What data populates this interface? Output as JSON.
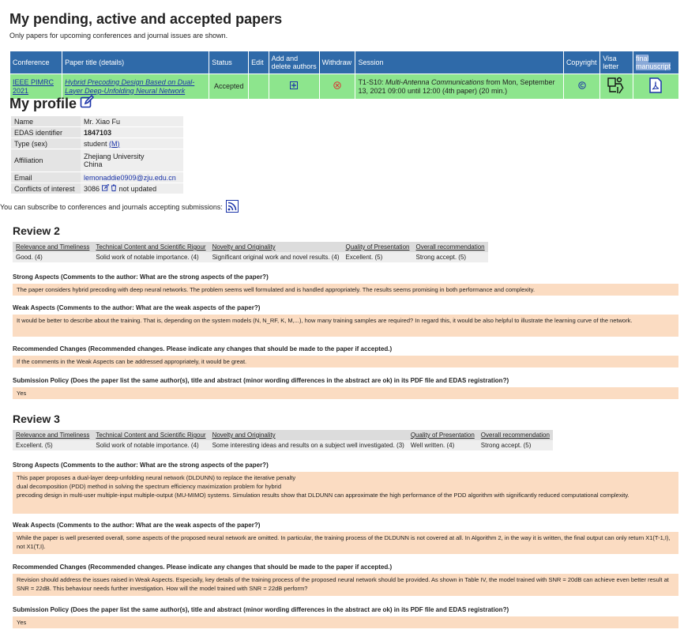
{
  "page": {
    "title": "My pending, active and accepted papers",
    "subtitle": "Only papers for upcoming conferences and journal issues are shown."
  },
  "papers": {
    "headers": [
      "Conference",
      "Paper title (details)",
      "Status",
      "Edit",
      "Add and delete authors",
      "Withdraw",
      "Session",
      "Copyright",
      "Visa letter",
      "final manuscript"
    ],
    "row": {
      "conference": "IEEE PIMRC 2021",
      "title": "Hybrid Precoding Design Based on Dual-Layer Deep-Unfolding Neural Network",
      "status": "Accepted",
      "session_prefix": "T1-S10: ",
      "session_name": "Multi-Antenna Communications",
      "session_suffix": " from Mon, September 13, 2021 09:00 until 12:00 (4th paper) (20 min.)"
    },
    "colors": {
      "header_bg": "#2f6aa9",
      "row_bg": "#8de58d"
    }
  },
  "profile": {
    "title": "My profile",
    "rows": [
      {
        "key": "Name",
        "value": "Mr. Xiao Fu"
      },
      {
        "key": "EDAS identifier",
        "value": "1847103"
      },
      {
        "key": "Type (sex)",
        "value": "student",
        "extra": "(M)"
      },
      {
        "key": "Affiliation",
        "value": "Zhejiang University",
        "value2": "China"
      },
      {
        "key": "Email",
        "value": "lemonaddie0909@zju.edu.cn"
      },
      {
        "key": "Conflicts of interest",
        "value": "3086",
        "note": "not updated"
      }
    ],
    "subscribe_text": "You can subscribe to conferences and journals accepting submissions:"
  },
  "reviews": [
    {
      "title": "Review 2",
      "score_headers": [
        "Relevance and Timeliness",
        "Technical Content and Scientific Rigour",
        "Novelty and Originality",
        "Quality of Presentation",
        "Overall recommendation"
      ],
      "scores": [
        "Good. (4)",
        "Solid work of notable importance. (4)",
        "Significant original work and novel results. (4)",
        "Excellent. (5)",
        "Strong accept. (5)"
      ],
      "sections": [
        {
          "q": "Strong Aspects (Comments to the author: What are the strong aspects of the paper?)",
          "a": "The paper considers hybrid precoding with deep neural networks. The problem seems well formulated and is handled appropriately. The results seems promising in both performance and complexity."
        },
        {
          "q": "Weak Aspects (Comments to the author: What are the weak aspects of the paper?)",
          "a": "It would be better to describe about the training. That is, depending on the system models (N, N_RF, K, M,...), how many training samples are required? In regard this, it would be also helpful to illustrate the learning curve of the network."
        },
        {
          "q": "Recommended Changes (Recommended changes. Please indicate any changes that should be made to the paper if accepted.)",
          "a": "If the comments in the Weak Aspects can be addressed appropriately, it would be great."
        },
        {
          "q": "Submission Policy (Does the paper list the same author(s), title and abstract (minor wording differences in the abstract are ok) in its PDF file and EDAS registration?)",
          "a": "Yes"
        }
      ]
    },
    {
      "title": "Review 3",
      "score_headers": [
        "Relevance and Timeliness",
        "Technical Content and Scientific Rigour",
        "Novelty and Originality",
        "Quality of Presentation",
        "Overall recommendation"
      ],
      "scores": [
        "Excellent. (5)",
        "Solid work of notable importance. (4)",
        "Some interesting ideas and results on a subject well investigated. (3)",
        "Well written. (4)",
        "Strong accept. (5)"
      ],
      "sections": [
        {
          "q": "Strong Aspects (Comments to the author: What are the strong aspects of the paper?)",
          "a": "This paper proposes a dual-layer deep-unfolding neural network (DLDUNN) to replace the iterative penalty\ndual decomposition (PDD) method in solving the spectrum efficiency maximization problem for hybrid\nprecoding design in multi-user multiple-input multiple-output (MU-MIMO) systems. Simulation results show that DLDUNN can approximate the high performance of the PDD algorithm with significantly reduced computational complexity."
        },
        {
          "q": "Weak Aspects (Comments to the author: What are the weak aspects of the paper?)",
          "a": "While the paper is well presented overall, some aspects of the proposed neural network are omitted. In particular, the training process of the DLDUNN is not covered at all. In Algorithm 2, in the way it is written, the final output can only return X1(T-1,I), not X1(T,I)."
        },
        {
          "q": "Recommended Changes (Recommended changes. Please indicate any changes that should be made to the paper if accepted.)",
          "a": "Revision should address the issues raised in Weak Aspects. Especially, key details of the training process of the proposed neural network should be provided. As shown in Table IV, the model trained with SNR = 20dB can achieve even better result at SNR = 22dB. This behaviour needs further investigation. How will the model trained with SNR = 22dB perform?"
        },
        {
          "q": "Submission Policy (Does the paper list the same author(s), title and abstract (minor wording differences in the abstract are ok) in its PDF file and EDAS registration?)",
          "a": "Yes"
        }
      ]
    }
  ]
}
